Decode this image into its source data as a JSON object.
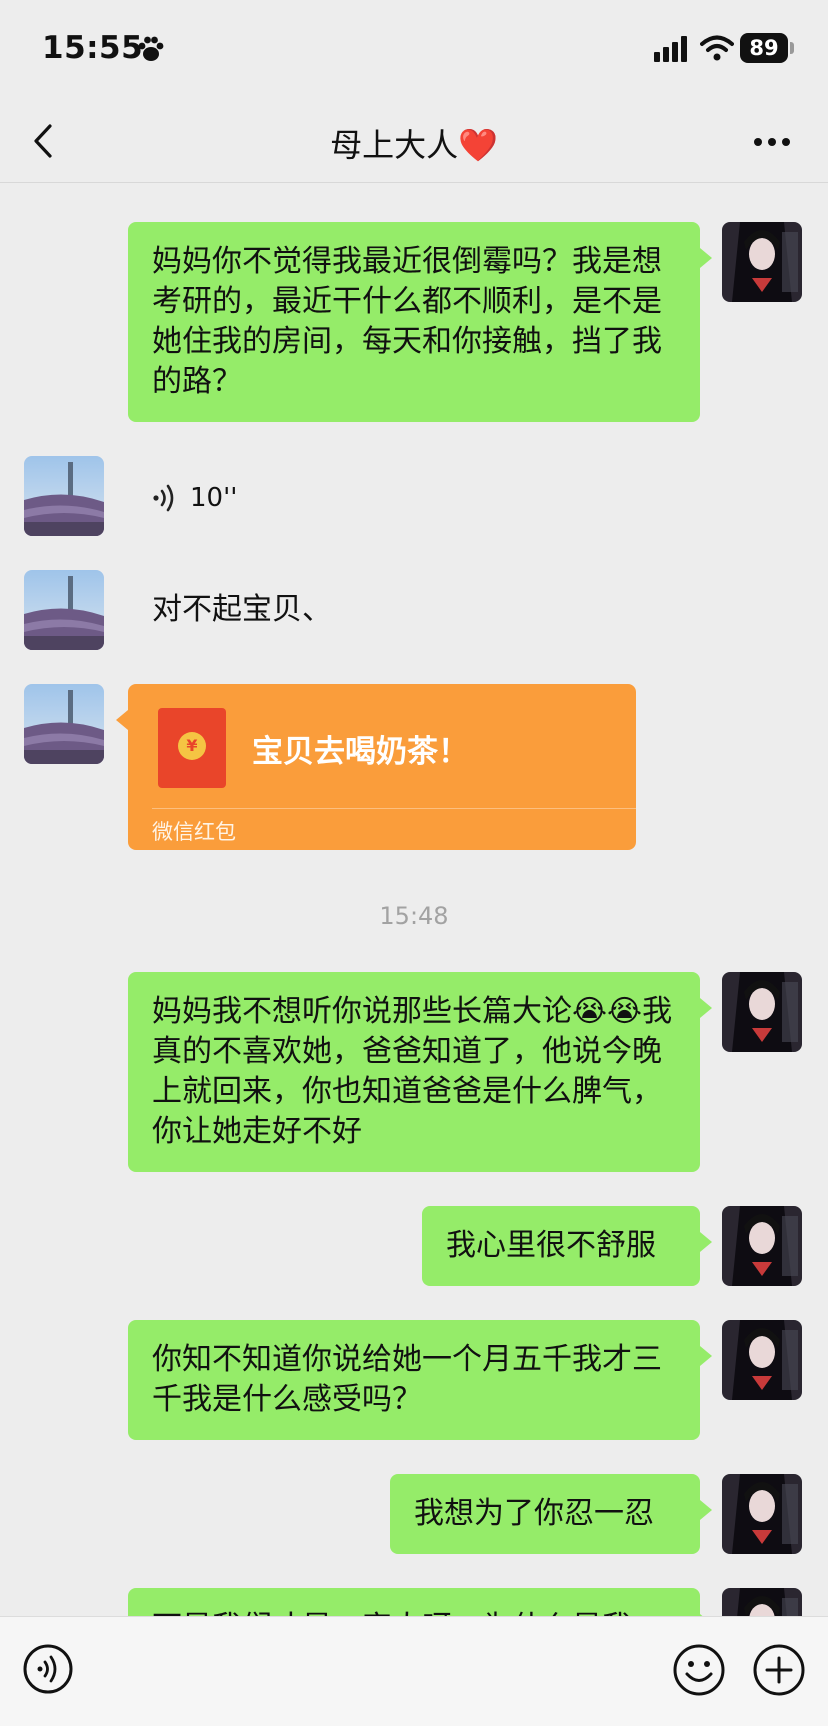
{
  "status_bar": {
    "time": "15:55",
    "battery": "89"
  },
  "nav": {
    "title": "母上大人",
    "title_emoji": "❤️"
  },
  "messages": {
    "m1": "妈妈你不觉得我最近很倒霉吗？我是想考研的，最近干什么都不顺利，是不是她住我的房间，每天和你接触，挡了我的路？",
    "voice_duration": "10''",
    "m3": "对不起宝贝、",
    "red_packet": {
      "title": "宝贝去喝奶茶！",
      "label": "微信红包",
      "coin": "¥"
    },
    "timestamp": "15:48",
    "m5": "妈妈我不想听你说那些长篇大论😭😭我真的不喜欢她，爸爸知道了，他说今晚上就回来，你也知道爸爸是什么脾气，你让她走好不好",
    "m6": "我心里很不舒服",
    "m7": "你知不知道你说给她一个月五千我才三千我是什么感受吗？",
    "m8": "我想为了你忍一忍",
    "m9_partial": "可是我们才是一家人呀，为什么是我"
  },
  "colors": {
    "bubble_green": "#95ec69",
    "red_packet": "#fa9d3b",
    "background": "#ededed"
  }
}
